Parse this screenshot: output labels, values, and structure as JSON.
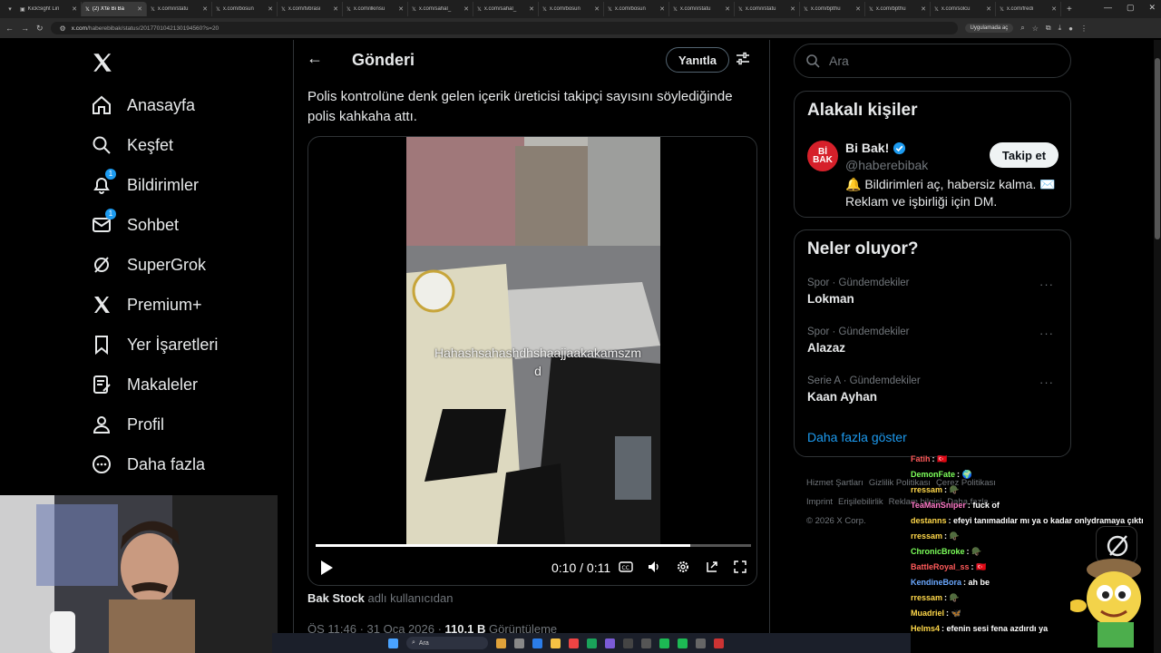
{
  "browser": {
    "tabs": [
      {
        "label": "KickSight Lin",
        "active": false
      },
      {
        "label": "(2) X'te Bi Ba",
        "active": true
      },
      {
        "label": "x.com/i/statu",
        "active": false
      },
      {
        "label": "x.com/bosun",
        "active": false
      },
      {
        "label": "x.com/tvbrasi",
        "active": false
      },
      {
        "label": "x.com/ilkinsu",
        "active": false
      },
      {
        "label": "x.com/sahal_",
        "active": false
      },
      {
        "label": "x.com/sahal_",
        "active": false
      },
      {
        "label": "x.com/bosun",
        "active": false
      },
      {
        "label": "x.com/bosun",
        "active": false
      },
      {
        "label": "x.com/i/statu",
        "active": false
      },
      {
        "label": "x.com/i/statu",
        "active": false
      },
      {
        "label": "x.com/bpthu",
        "active": false
      },
      {
        "label": "x.com/bpthu",
        "active": false
      },
      {
        "label": "x.com/solcu",
        "active": false
      },
      {
        "label": "x.com/fredi",
        "active": false
      }
    ],
    "url_host": "x.com",
    "url_path": "/haberebibak/status/2017701042130194560?s=20",
    "app_pill": "Uygulamada aç"
  },
  "nav": {
    "items": [
      {
        "label": "Anasayfa",
        "icon": "home-icon"
      },
      {
        "label": "Keşfet",
        "icon": "search-icon"
      },
      {
        "label": "Bildirimler",
        "icon": "bell-icon",
        "badge": "1"
      },
      {
        "label": "Sohbet",
        "icon": "mail-icon",
        "badge": "1"
      },
      {
        "label": "SuperGrok",
        "icon": "grok-icon"
      },
      {
        "label": "Premium+",
        "icon": "x-premium-icon"
      },
      {
        "label": "Yer İşaretleri",
        "icon": "bookmark-icon"
      },
      {
        "label": "Makaleler",
        "icon": "article-icon"
      },
      {
        "label": "Profil",
        "icon": "profile-icon"
      },
      {
        "label": "Daha fazla",
        "icon": "more-circle-icon"
      }
    ]
  },
  "post": {
    "header_title": "Gönderi",
    "reply_label": "Yanıtla",
    "text": "Polis kontrolüne denk gelen içerik üreticisi takipçi sayısını söylediğinde polis kahkaha attı.",
    "video_overlay_text": "Hahashsahashdhshaajjaakakamszm d",
    "video_time": "0:10 / 0:11",
    "video_progress": 0.86,
    "attribution_user": "Bak Stock",
    "attribution_suffix": "adlı kullanıcıdan",
    "meta_time": "ÖS 11:46 · 31 Oca 2026 ·",
    "meta_views_count": "110,1 B",
    "meta_views_label": "Görüntüleme"
  },
  "search": {
    "placeholder": "Ara"
  },
  "related": {
    "title": "Alakalı kişiler",
    "name": "Bi Bak!",
    "handle": "@haberebibak",
    "bio": "🔔 Bildirimleri aç, habersiz kalma. ✉️ Reklam ve işbirliği için DM.",
    "follow_label": "Takip et",
    "avatar_text": "Bİ BAK"
  },
  "trends": {
    "title": "Neler oluyor?",
    "items": [
      {
        "context": "Spor · Gündemdekiler",
        "name": "Lokman"
      },
      {
        "context": "Spor · Gündemdekiler",
        "name": "Alazaz"
      },
      {
        "context": "Serie A · Gündemdekiler",
        "name": "Kaan Ayhan"
      }
    ],
    "show_more": "Daha fazla göster"
  },
  "footer": {
    "links": [
      "Hizmet Şartları",
      "Gizlilik Politikası",
      "Çerez Politikası",
      "Imprint",
      "Erişilebilirlik",
      "Reklam bilgisi",
      "Daha fazla ···"
    ],
    "copyright": "© 2026 X Corp."
  },
  "chat": [
    {
      "user": "Fatih",
      "msg": "🇹🇷",
      "color": "#ff5a5a"
    },
    {
      "user": "DemonFate",
      "msg": "🌍",
      "color": "#7cff5a"
    },
    {
      "user": "rressam",
      "msg": "🪖",
      "color": "#ffd84a"
    },
    {
      "user": "TeaManSniper",
      "msg": "fuck of",
      "color": "#ff7ac8"
    },
    {
      "user": "destanns",
      "msg": "efeyi tanımadılar mı ya o kadar onlydramaya çıktı",
      "color": "#ffd84a"
    },
    {
      "user": "rressam",
      "msg": "🪖",
      "color": "#ffd84a"
    },
    {
      "user": "ChronicBroke",
      "msg": "🪖",
      "color": "#7cff5a"
    },
    {
      "user": "BattleRoyal_ss",
      "msg": "🇹🇷",
      "color": "#ff5a5a"
    },
    {
      "user": "KendineBora",
      "msg": "ah be",
      "color": "#6aa8ff"
    },
    {
      "user": "rressam",
      "msg": "🪖",
      "color": "#ffd84a"
    },
    {
      "user": "Muadriel",
      "msg": "🦋",
      "color": "#ffd84a"
    },
    {
      "user": "Helms4",
      "msg": "efenin sesi fena azdırdı ya",
      "color": "#ffd84a"
    }
  ],
  "taskbar": {
    "search_label": "Ara"
  },
  "colors": {
    "accent": "#1d9bf0",
    "bg": "#000000",
    "border": "#2f3336",
    "muted": "#71767b"
  }
}
